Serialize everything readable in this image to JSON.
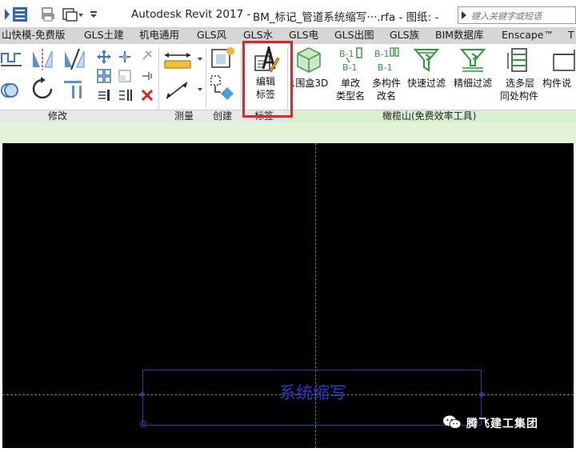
{
  "window": {
    "title": "Autodesk Revit 2017 -",
    "document": "BM_标记_管道系统缩写···.rfa - 图纸: -",
    "search_placeholder": "键入关键字或短语"
  },
  "tabs": [
    "山快模-免费版",
    "GLS土建",
    "机电通用",
    "GLS风",
    "GLS水",
    "GLS电",
    "GLS出图",
    "GLS族",
    "BIM数据库",
    "Enscape™",
    "T"
  ],
  "ribbon": {
    "edit_label": {
      "line1": "编辑",
      "line2": "标签"
    },
    "bounding_3d": "1围盒3D",
    "single_change": {
      "line1": "单改",
      "line2": "类型名"
    },
    "multi_change": {
      "line1": "多构件",
      "line2": "改名"
    },
    "quick_filter": "快速过滤",
    "fine_filter": "精细过滤",
    "multi_floor": {
      "line1": "选多层",
      "line2": "同处构件"
    },
    "component": "构件说",
    "bm_text": "B-1"
  },
  "panels": {
    "modify": "修改",
    "measure": "测量",
    "create": "创建",
    "label": "标签",
    "ganlanshan": "橄榄山(免费效率工具)"
  },
  "canvas": {
    "label_text": "系统缩写"
  },
  "watermark": {
    "text": "腾飞建工集团"
  },
  "colors": {
    "canvas_bg": "#000000",
    "label_blue": "#2f37c8",
    "highlight_red": "#e8222a",
    "options_green": "#e2f3da",
    "reference_green": "#3d9a3d"
  }
}
